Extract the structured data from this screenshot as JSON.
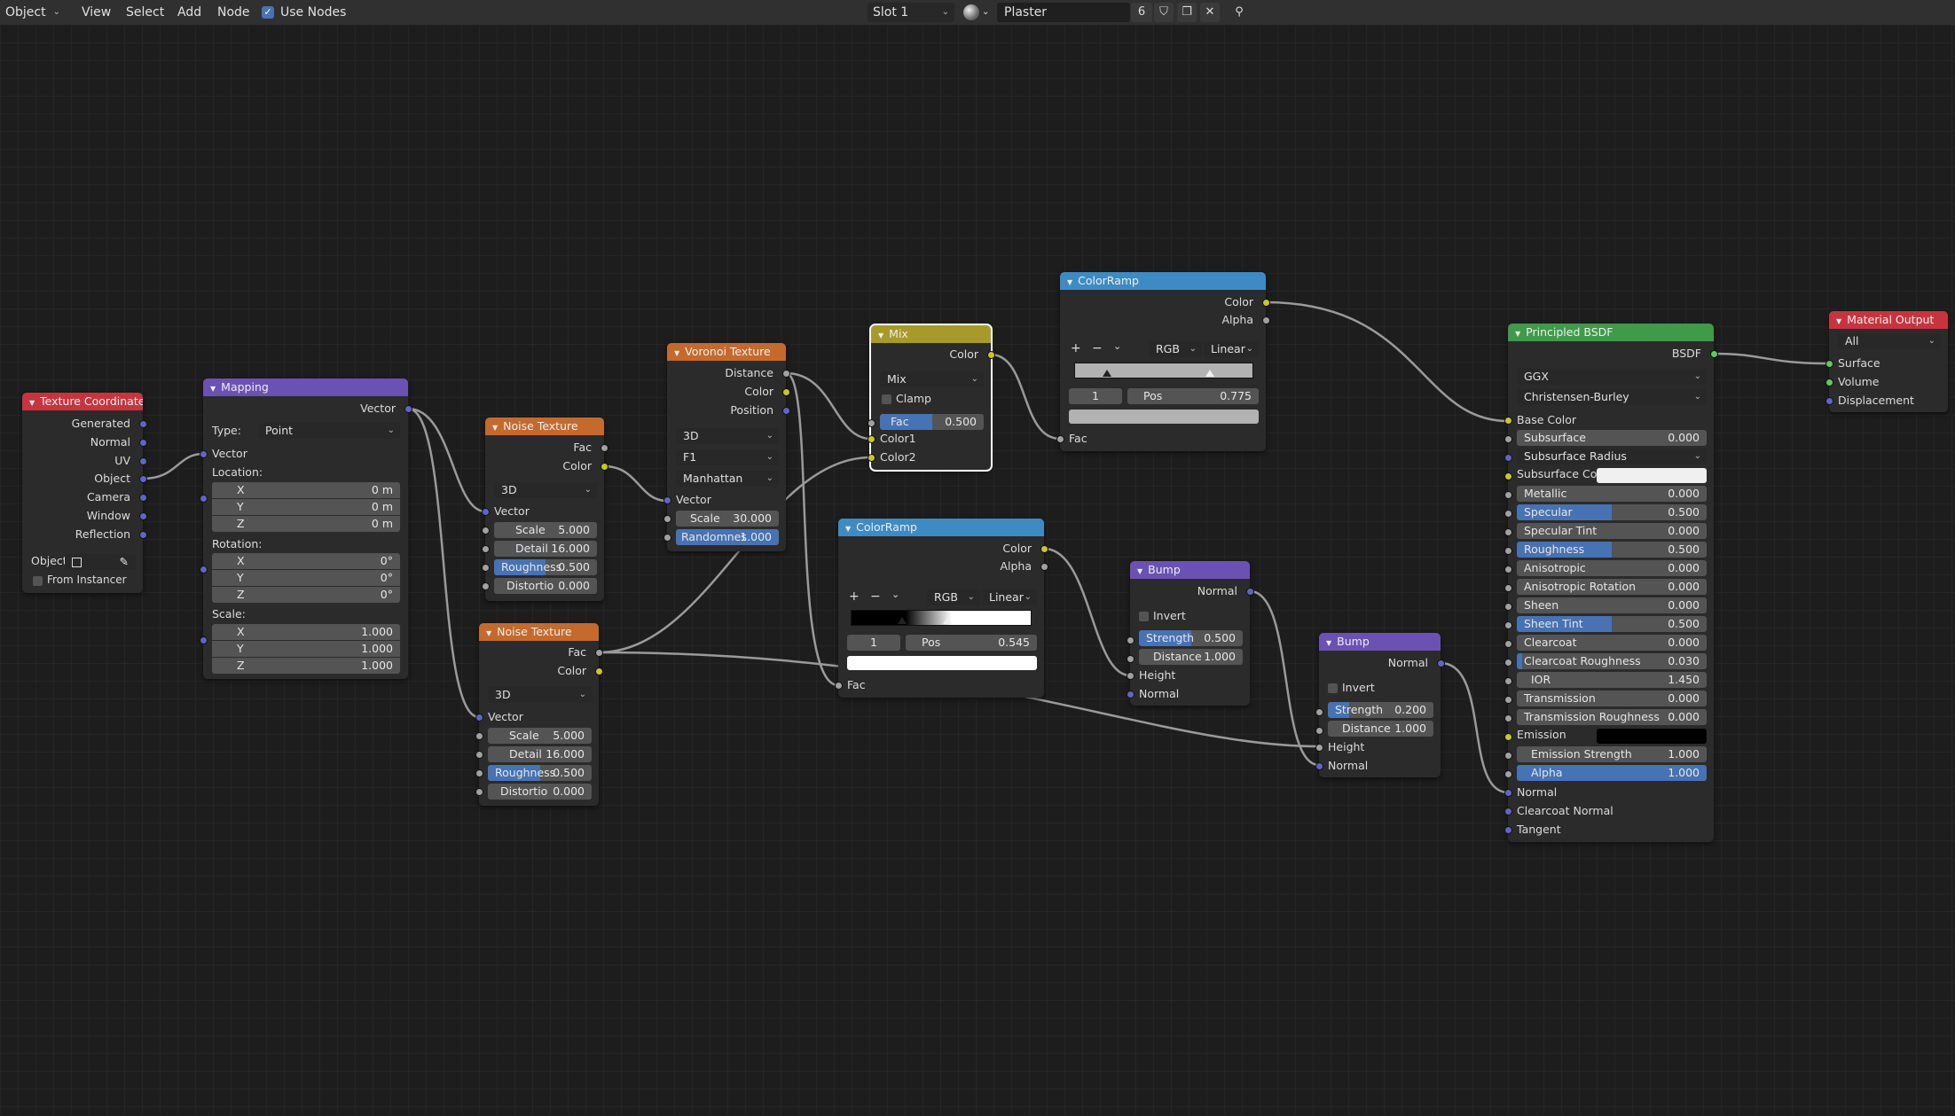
{
  "header": {
    "mode": "Object",
    "menu": [
      "View",
      "Select",
      "Add",
      "Node"
    ],
    "use_nodes_label": "Use Nodes",
    "slot": "Slot 1",
    "material_name": "Plaster",
    "user_count": "6"
  },
  "nodes": {
    "texcoord": {
      "title": "Texture Coordinate",
      "outputs": [
        "Generated",
        "Normal",
        "UV",
        "Object",
        "Camera",
        "Window",
        "Reflection"
      ],
      "object_label": "Object:",
      "from_instancer": "From Instancer"
    },
    "mapping": {
      "title": "Mapping",
      "out_vector": "Vector",
      "type_label": "Type:",
      "type_value": "Point",
      "in_vector": "Vector",
      "location": "Location:",
      "rotation": "Rotation:",
      "scale": "Scale:",
      "x": "X",
      "y": "Y",
      "z": "Z",
      "loc_x": "0 m",
      "loc_y": "0 m",
      "loc_z": "0 m",
      "rot_x": "0°",
      "rot_y": "0°",
      "rot_z": "0°",
      "scl_x": "1.000",
      "scl_y": "1.000",
      "scl_z": "1.000"
    },
    "noise1": {
      "title": "Noise Texture",
      "out_fac": "Fac",
      "out_color": "Color",
      "dim": "3D",
      "in_vector": "Vector",
      "scale_label": "Scale",
      "scale": "5.000",
      "detail_label": "Detail",
      "detail": "16.000",
      "rough_label": "Roughness",
      "rough": "0.500",
      "rough_fill": 0.5,
      "dist_label": "Distortio",
      "dist": "0.000"
    },
    "noise2": {
      "title": "Noise Texture",
      "out_fac": "Fac",
      "out_color": "Color",
      "dim": "3D",
      "in_vector": "Vector",
      "scale_label": "Scale",
      "scale": "5.000",
      "detail_label": "Detail",
      "detail": "16.000",
      "rough_label": "Roughness",
      "rough": "0.500",
      "rough_fill": 0.5,
      "dist_label": "Distortio",
      "dist": "0.000"
    },
    "voronoi": {
      "title": "Voronoi Texture",
      "out_distance": "Distance",
      "out_color": "Color",
      "out_position": "Position",
      "dim": "3D",
      "feature": "F1",
      "metric": "Manhattan",
      "in_vector": "Vector",
      "scale_label": "Scale",
      "scale": "30.000",
      "rand_label": "Randomnes",
      "rand": "1.000",
      "rand_fill": 1.0
    },
    "mix": {
      "title": "Mix",
      "out_color": "Color",
      "blend": "Mix",
      "clamp": "Clamp",
      "fac_label": "Fac",
      "fac": "0.500",
      "fac_fill": 0.5,
      "in_color1": "Color1",
      "in_color2": "Color2"
    },
    "ramp1": {
      "title": "ColorRamp",
      "out_color": "Color",
      "out_alpha": "Alpha",
      "plus": "+",
      "minus": "−",
      "mode": "RGB",
      "interp": "Linear",
      "index": "1",
      "pos_label": "Pos",
      "pos": "0.775",
      "in_fac": "Fac"
    },
    "ramp2": {
      "title": "ColorRamp",
      "out_color": "Color",
      "out_alpha": "Alpha",
      "plus": "+",
      "minus": "−",
      "mode": "RGB",
      "interp": "Linear",
      "index": "1",
      "pos_label": "Pos",
      "pos": "0.545",
      "in_fac": "Fac"
    },
    "bump1": {
      "title": "Bump",
      "out_normal": "Normal",
      "invert": "Invert",
      "strength_label": "Strength",
      "strength": "0.500",
      "strength_fill": 0.5,
      "distance_label": "Distance",
      "distance": "1.000",
      "in_height": "Height",
      "in_normal": "Normal"
    },
    "bump2": {
      "title": "Bump",
      "out_normal": "Normal",
      "invert": "Invert",
      "strength_label": "Strength",
      "strength": "0.200",
      "strength_fill": 0.2,
      "distance_label": "Distance",
      "distance": "1.000",
      "in_height": "Height",
      "in_normal": "Normal"
    },
    "principled": {
      "title": "Principled BSDF",
      "out_bsdf": "BSDF",
      "distribution": "GGX",
      "sss_method": "Christensen-Burley",
      "base_color": "Base Color",
      "subsurface_label": "Subsurface",
      "subsurface": "0.000",
      "subsurface_radius": "Subsurface Radius",
      "subsurface_color": "Subsurface Co...",
      "metallic_label": "Metallic",
      "metallic": "0.000",
      "specular_label": "Specular",
      "specular": "0.500",
      "specular_fill": 0.5,
      "spec_tint_label": "Specular Tint",
      "spec_tint": "0.000",
      "roughness_label": "Roughness",
      "roughness": "0.500",
      "roughness_fill": 0.5,
      "aniso_label": "Anisotropic",
      "aniso": "0.000",
      "aniso_rot_label": "Anisotropic Rotation",
      "aniso_rot": "0.000",
      "sheen_label": "Sheen",
      "sheen": "0.000",
      "sheen_tint_label": "Sheen Tint",
      "sheen_tint": "0.500",
      "sheen_tint_fill": 0.5,
      "clearcoat_label": "Clearcoat",
      "clearcoat": "0.000",
      "cc_rough_label": "Clearcoat Roughness",
      "cc_rough": "0.030",
      "cc_rough_fill": 0.03,
      "ior_label": "IOR",
      "ior": "1.450",
      "transmission_label": "Transmission",
      "transmission": "0.000",
      "trans_rough_label": "Transmission Roughness",
      "trans_rough": "0.000",
      "emission": "Emission",
      "emission_strength_label": "Emission Strength",
      "emission_strength": "1.000",
      "alpha_label": "Alpha",
      "alpha": "1.000",
      "alpha_fill": 1.0,
      "normal": "Normal",
      "clearcoat_normal": "Clearcoat Normal",
      "tangent": "Tangent"
    },
    "output": {
      "title": "Material Output",
      "target": "All",
      "surface": "Surface",
      "volume": "Volume",
      "displacement": "Displacement"
    }
  },
  "colors": {
    "header_input": "#c7343f",
    "header_vector": "#6a52b5",
    "header_texture": "#c46a2c",
    "header_color": "#a89a2a",
    "header_converter": "#3e8bc4",
    "header_shader": "#3f9a4a",
    "header_output": "#c7343f",
    "socket_vector": "#6363c7",
    "socket_color": "#c7c729",
    "socket_float": "#a1a1a1",
    "socket_shader": "#63c763",
    "slider_fill": "#4772b3"
  }
}
